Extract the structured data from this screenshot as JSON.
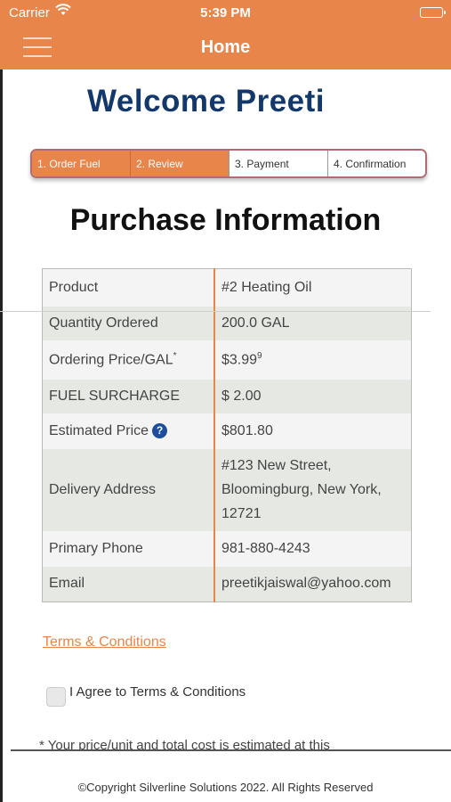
{
  "status_bar": {
    "carrier": "Carrier",
    "time": "5:39 PM",
    "wifi_icon": "wifi-icon",
    "battery_icon": "battery-icon"
  },
  "nav": {
    "title": "Home",
    "menu_icon": "hamburger-menu-icon"
  },
  "welcome": "Welcome Preeti",
  "steps": [
    {
      "label": "1. Order Fuel",
      "state": "active"
    },
    {
      "label": "2. Review",
      "state": "active"
    },
    {
      "label": "3. Payment",
      "state": "inactive"
    },
    {
      "label": "4. Confirmation",
      "state": "inactive"
    }
  ],
  "purchase_title": "Purchase Information",
  "rows": [
    {
      "label": "Product",
      "value": "#2 Heating Oil"
    },
    {
      "label": "Quantity Ordered",
      "value": "200.0 GAL"
    },
    {
      "label": "Ordering Price/GAL",
      "label_sup": "*",
      "value": "$3.99",
      "value_sup": "9"
    },
    {
      "label": "FUEL SURCHARGE",
      "value": "$ 2.00"
    },
    {
      "label": "Estimated Price",
      "help_icon": "?",
      "value": "$801.80"
    },
    {
      "label": "Delivery Address",
      "value_lines": [
        "#123 New Street,",
        "Bloomingburg, New York,",
        "12721"
      ]
    },
    {
      "label": "Primary Phone",
      "value": "981-880-4243"
    },
    {
      "label": "Email",
      "value": "preetikjaiswal@yahoo.com"
    }
  ],
  "terms_link": "Terms & Conditions",
  "agree_label": "I Agree to Terms & Conditions",
  "note": "* Your price/unit and total cost is estimated at this",
  "copyright": "©Copyright Silverline Solutions 2022. All Rights Reserved",
  "colors": {
    "accent": "#e8854a",
    "welcome": "#13386b",
    "help": "#1d4e9c"
  }
}
